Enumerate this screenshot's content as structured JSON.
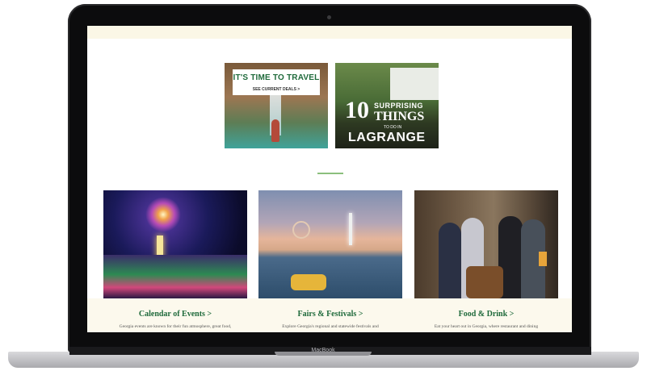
{
  "device": {
    "brand_label": "MacBook"
  },
  "ads": [
    {
      "headline": "IT'S TIME TO TRAVEL",
      "subline": "SEE CURRENT DEALS >"
    },
    {
      "number": "10",
      "line1": "SURPRISING",
      "line2": "THINGS",
      "line3": "TO DO IN",
      "city": "LAGRANGE"
    }
  ],
  "cards": [
    {
      "title": "Calendar of Events >",
      "desc": "Georgia events are known for their fun atmosphere, great food,"
    },
    {
      "title": "Fairs & Festivals >",
      "desc": "Explore Georgia's regional and statewide festivals and"
    },
    {
      "title": "Food & Drink >",
      "desc": "Eat your heart out in Georgia, where restaurant and dining"
    }
  ],
  "colors": {
    "accent_green": "#1f6a3b",
    "divider_green": "#8bbf7d",
    "cream": "#fcf9ed"
  }
}
